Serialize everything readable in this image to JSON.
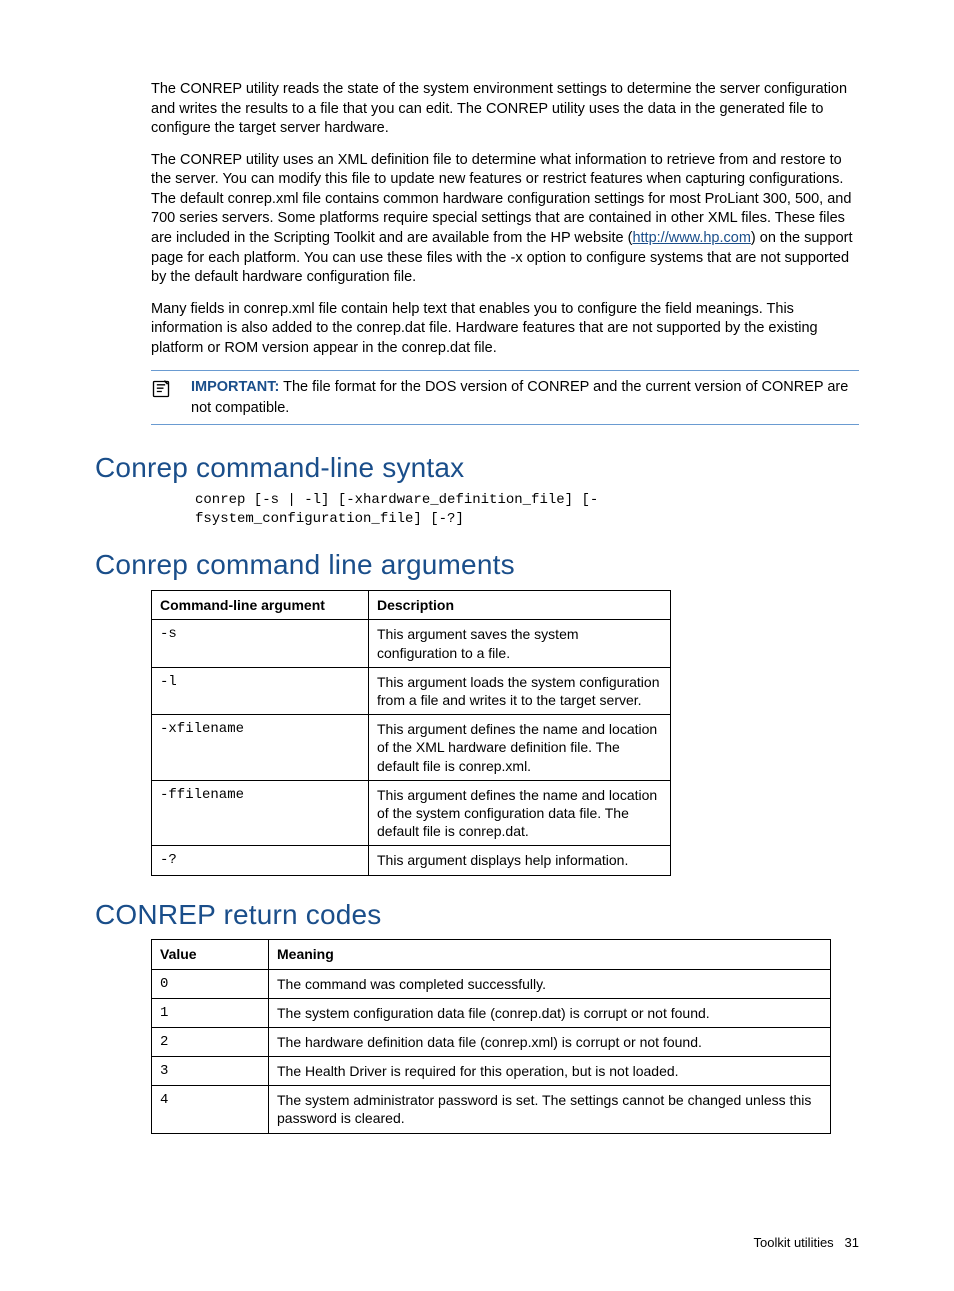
{
  "paragraphs": {
    "p1": "The CONREP utility reads the state of the system environment settings to determine the server configuration and writes the results to a file that you can edit. The CONREP utility uses the data in the generated file to configure the target server hardware.",
    "p2a": "The CONREP utility uses an XML definition file to determine what information to retrieve from and restore to the server. You can modify this file to update new features or restrict features when capturing configurations. The default conrep.xml file contains common hardware configuration settings for most ProLiant 300, 500, and 700 series servers. Some platforms require special settings that are contained in other XML files. These files are included in the Scripting Toolkit and are available from the HP website (",
    "p2link": "http://www.hp.com",
    "p2b": ") on the support page for each platform. You can use these files with the -x option to configure systems that are not supported by the default hardware configuration file.",
    "p3": "Many fields in conrep.xml file contain help text that enables you to configure the field meanings. This information is also added to the conrep.dat file. Hardware features that are not supported by the existing platform or ROM version appear in the conrep.dat file."
  },
  "important": {
    "label": "IMPORTANT:",
    "text": "The file format for the DOS version of CONREP and the current version of CONREP are not compatible."
  },
  "sections": {
    "syntax_title": "Conrep command-line syntax",
    "syntax_code": "conrep [-s | -l] [-xhardware_definition_file] [-\nfsystem_configuration_file] [-?]",
    "args_title": "Conrep command line arguments",
    "return_title": "CONREP return codes"
  },
  "args_table": {
    "headers": [
      "Command-line argument",
      "Description"
    ],
    "rows": [
      {
        "arg": "-s",
        "desc": "This argument saves the system configuration to a file."
      },
      {
        "arg": "-l",
        "desc": "This argument loads the system configuration from a file and writes it to the target server."
      },
      {
        "arg": "-xfilename",
        "desc": "This argument defines the name and location of the XML hardware definition file. The default file is conrep.xml."
      },
      {
        "arg": "-ffilename",
        "desc": "This argument defines the name and location of the system configuration data file. The default file is conrep.dat."
      },
      {
        "arg": "-?",
        "desc": "This argument displays help information."
      }
    ]
  },
  "return_table": {
    "headers": [
      "Value",
      "Meaning"
    ],
    "rows": [
      {
        "val": "0",
        "desc": "The command was completed successfully."
      },
      {
        "val": "1",
        "desc": "The system configuration data file (conrep.dat) is corrupt or not found."
      },
      {
        "val": "2",
        "desc": "The hardware definition data file (conrep.xml) is corrupt or not found."
      },
      {
        "val": "3",
        "desc": "The Health Driver is required for this operation, but is not loaded."
      },
      {
        "val": "4",
        "desc": "The system administrator password is set. The settings cannot be changed unless this password is cleared."
      }
    ]
  },
  "footer": {
    "section": "Toolkit utilities",
    "page": "31"
  }
}
